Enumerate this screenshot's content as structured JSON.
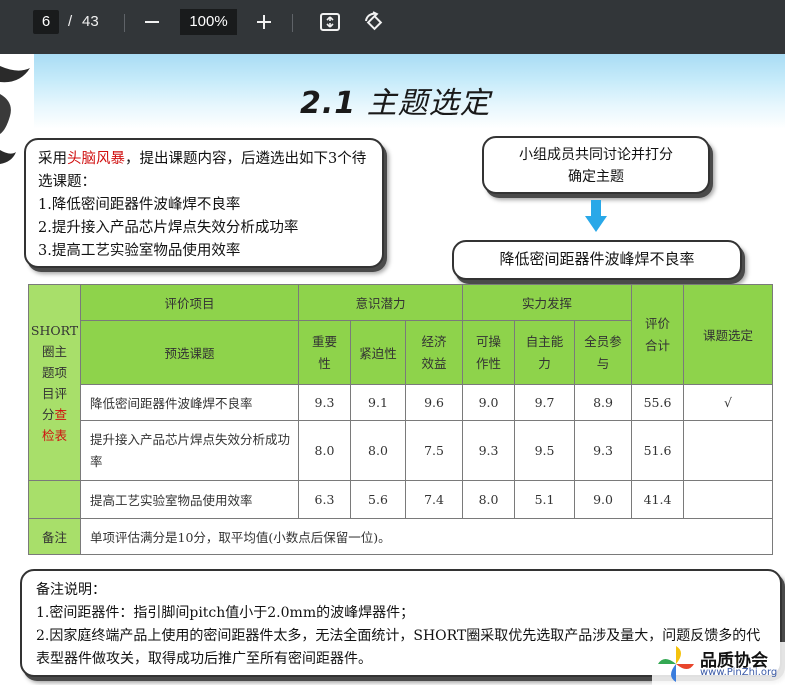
{
  "toolbar": {
    "current_page": "6",
    "separator": "/",
    "total_pages": "43",
    "zoom": "100%",
    "icons": [
      "minus-icon",
      "plus-icon",
      "fit-page-icon",
      "rotate-icon"
    ]
  },
  "slide": {
    "title_number": "2.1",
    "title_text": "主题选定",
    "intro": {
      "prefix": "采用",
      "highlight": "头脑风暴",
      "suffix": "，提出课题内容，后遴选出如下3个待选课题：",
      "items": [
        "1.降低密间距器件波峰焊不良率",
        "2.提升接入产品芯片焊点失效分析成功率",
        "3.提高工艺实验室物品使用效率"
      ]
    },
    "group_box": [
      "小组成员共同讨论并打分",
      "确定主题"
    ],
    "arrow_color": "#29a8e8",
    "selected_topic": "降低密间距器件波峰焊不良率"
  },
  "table": {
    "side_label_lines": [
      "SHORT",
      "圈主",
      "题项",
      "目评",
      "分"
    ],
    "side_label_red": "查\n检表",
    "header_eval_item": "评价项目",
    "header_topic": "预选课题",
    "group_awareness": "意识潜力",
    "group_ability": "实力发挥",
    "col_headers": [
      "重要\n性",
      "紧迫性",
      "经济\n效益",
      "可操\n作性",
      "自主能\n力",
      "全员参\n与"
    ],
    "total_header": "评价\n合计",
    "select_header": "课题选定",
    "rows": [
      {
        "topic": "降低密间距器件波峰焊不良率",
        "scores": [
          "9.3",
          "9.1",
          "9.6",
          "9.0",
          "9.7",
          "8.9"
        ],
        "total": "55.6",
        "selected": "√"
      },
      {
        "topic": "提升接入产品芯片焊点失效分析成功率",
        "scores": [
          "8.0",
          "8.0",
          "7.5",
          "9.3",
          "9.5",
          "9.3"
        ],
        "total": "51.6",
        "selected": ""
      },
      {
        "topic": "提高工艺实验室物品使用效率",
        "scores": [
          "6.3",
          "5.6",
          "7.4",
          "8.0",
          "5.1",
          "9.0"
        ],
        "total": "41.4",
        "selected": ""
      }
    ],
    "remark_label": "备注",
    "remark_text": "单项评估满分是10分，取平均值(小数点后保留一位)。",
    "header_green": "#8ed34b"
  },
  "notes": {
    "title": "备注说明：",
    "line1": "1.密间距器件：指引脚间pitch值小于2.0mm的波峰焊器件；",
    "line2": "2.因家庭终端产品上使用的密间距器件太多，无法全面统计，SHORT圈采取优先选取产品涉及量大，问题反馈多的代表型器件做攻关，取得成功后推广至所有密间距器件。"
  },
  "watermark": {
    "name": "品质协会",
    "url": "www.PinZhi.org"
  }
}
